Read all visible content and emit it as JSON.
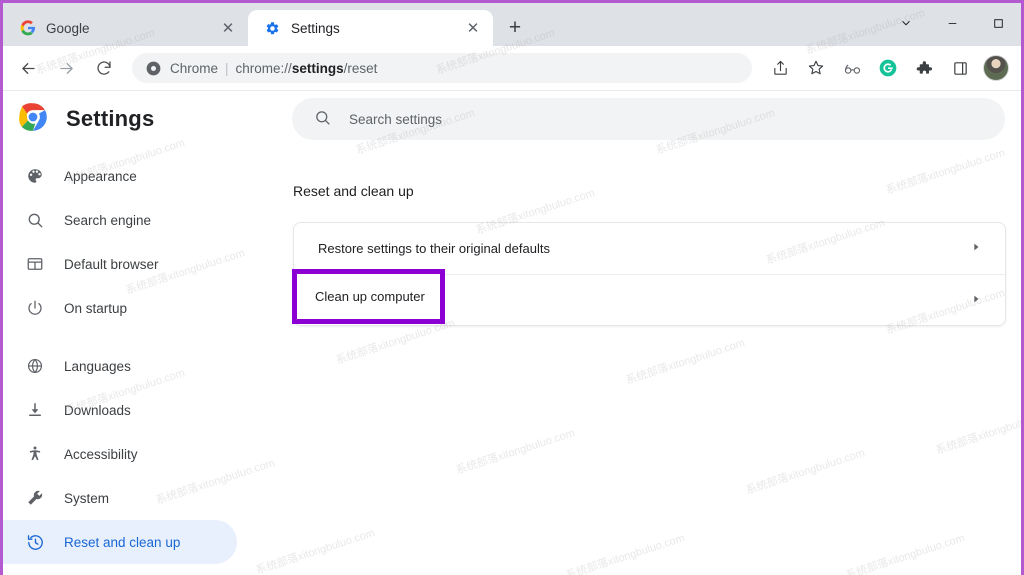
{
  "window": {
    "border_color": "#b45ad0",
    "controls": [
      {
        "name": "tab-search",
        "glyph": "⌄"
      },
      {
        "name": "minimize",
        "glyph": "—"
      },
      {
        "name": "maximize",
        "glyph": "□"
      }
    ]
  },
  "tabs": [
    {
      "title": "Google",
      "favicon": "google-g-icon",
      "active": false,
      "close_glyph": "✕"
    },
    {
      "title": "Settings",
      "favicon": "gear-icon",
      "active": true,
      "close_glyph": "✕"
    }
  ],
  "new_tab_glyph": "+",
  "toolbar": {
    "back_label": "←",
    "forward_label": "→",
    "reload_label": "⟳",
    "omnibox": {
      "scheme_label": "Chrome",
      "separator": "|",
      "url_prefix": "chrome://",
      "url_highlight": "settings",
      "url_suffix": "/reset",
      "full_url": "chrome://settings/reset"
    },
    "actions": [
      {
        "name": "share-icon"
      },
      {
        "name": "bookmark-star-icon"
      },
      {
        "name": "reading-glasses-icon"
      },
      {
        "name": "grammarly-icon",
        "color": "#15c39a"
      },
      {
        "name": "extensions-puzzle-icon"
      },
      {
        "name": "side-panel-icon"
      }
    ],
    "avatar_name": "profile-avatar"
  },
  "settings": {
    "brand_title": "Settings",
    "brand_icon": "chrome-logo",
    "search": {
      "placeholder": "Search settings",
      "value": "",
      "icon": "search-icon"
    }
  },
  "sidebar": {
    "items": [
      {
        "label": "Appearance",
        "icon": "palette-icon",
        "selected": false,
        "gap_after": false
      },
      {
        "label": "Search engine",
        "icon": "search-icon",
        "selected": false,
        "gap_after": false
      },
      {
        "label": "Default browser",
        "icon": "browser-window-icon",
        "selected": false,
        "gap_after": false
      },
      {
        "label": "On startup",
        "icon": "power-icon",
        "selected": false,
        "gap_after": true
      },
      {
        "label": "Languages",
        "icon": "globe-icon",
        "selected": false,
        "gap_after": false
      },
      {
        "label": "Downloads",
        "icon": "download-icon",
        "selected": false,
        "gap_after": false
      },
      {
        "label": "Accessibility",
        "icon": "accessibility-icon",
        "selected": false,
        "gap_after": false
      },
      {
        "label": "System",
        "icon": "wrench-icon",
        "selected": false,
        "gap_after": false
      },
      {
        "label": "Reset and clean up",
        "icon": "history-restore-icon",
        "selected": true,
        "gap_after": false
      }
    ],
    "selected_bg": "#e8f0fe",
    "selected_fg": "#1967d2"
  },
  "main": {
    "section_title": "Reset and clean up",
    "rows": [
      {
        "label": "Restore settings to their original defaults",
        "chevron": "▶",
        "highlighted": false
      },
      {
        "label": "Clean up computer",
        "chevron": "▶",
        "highlighted": true
      }
    ]
  },
  "annotation": {
    "color": "#8c00d4",
    "target_label": "Clean up computer"
  },
  "watermark_text": "系统部落xitongbuluo.com"
}
